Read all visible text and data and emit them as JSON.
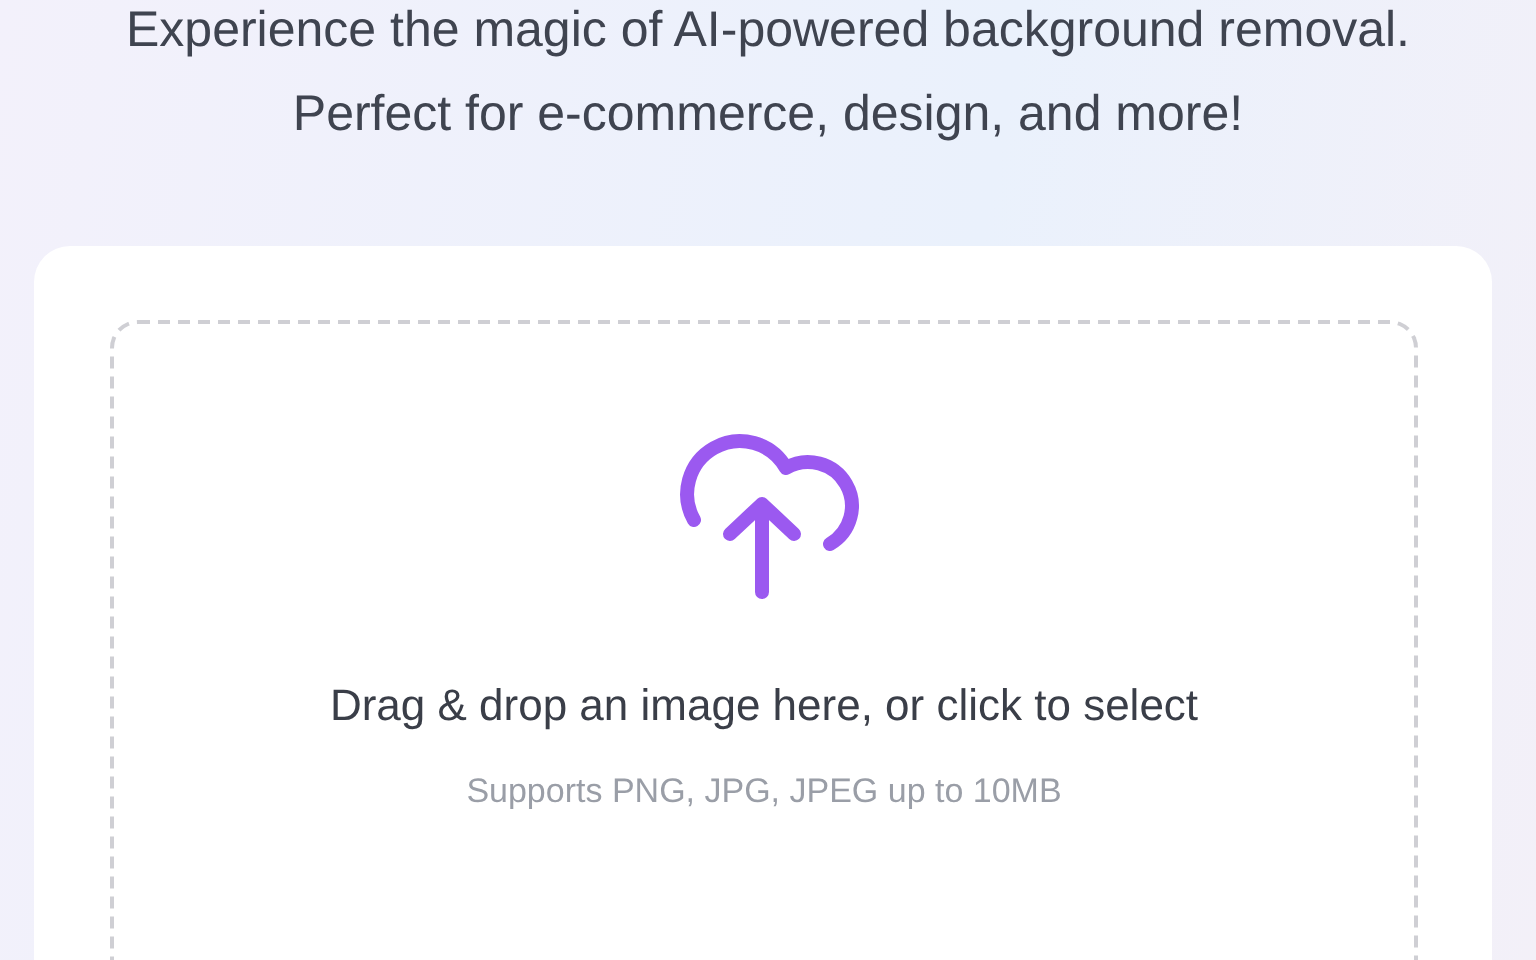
{
  "intro": "Experience the magic of AI-powered background removal. Perfect for e-commerce, design, and more!",
  "dropzone": {
    "prompt": "Drag & drop an image here, or click to select",
    "hint": "Supports PNG, JPG, JPEG up to 10MB"
  }
}
